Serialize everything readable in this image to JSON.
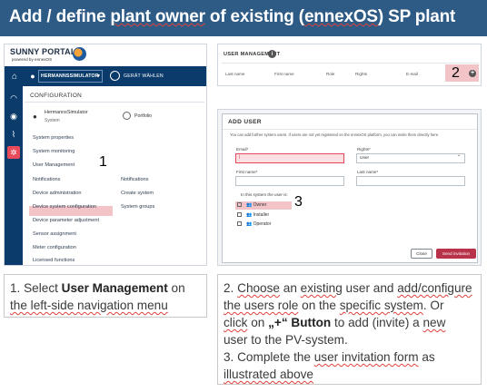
{
  "title": {
    "prefix": "Add / define ",
    "underlined": "plant owner",
    "mid": " of existing (",
    "ennex": "ennexOS",
    "suffix": ") SP plant"
  },
  "portal": {
    "logo": "SUNNY PORTAL",
    "logo_sub": "powered by ennexOS",
    "plant_selector": "HERMANNSSIMULATOR",
    "device_selector": "GERÄT WÄHLEN",
    "configuration_title": "CONFIGURATION",
    "plant_name": "HermannsSimulator",
    "plant_type": "System",
    "portfolio": "Portfolio",
    "menu_left": [
      "System properties",
      "System monitoring",
      "User Management",
      "Notifications",
      "Device administration",
      "Device system configuration",
      "Device parameter adjustment",
      "Sensor assignment",
      "Meter configuration",
      "Licensed functions"
    ],
    "menu_right": [
      "Notifications",
      "Create system",
      "System groups"
    ],
    "step_1": "1"
  },
  "user_management": {
    "title": "USER MANAGEMENT",
    "info": "i",
    "columns": [
      "Last name",
      "First name",
      "Role",
      "Rights",
      "E-mail"
    ],
    "add_symbol": "+",
    "step_2": "2"
  },
  "add_user": {
    "title": "ADD USER",
    "description": "You can add further system users. If users are not yet registered on the ennexOS platform, you can invite them directly here.",
    "email_label": "Email*",
    "email_value": "|",
    "rights_label": "Rights*",
    "rights_value": "User",
    "rights_arrow": "⌄",
    "first_name_label": "First name*",
    "last_name_label": "Last name*",
    "role_question": "In this system the user is:",
    "roles": [
      "Owner",
      "Installer",
      "Operator"
    ],
    "step_3": "3",
    "close_button": "Close",
    "send_button": "Send invitation"
  },
  "caption_left": {
    "prefix": "1. Select ",
    "bold": "User Management",
    "mid": " on",
    "line2": "the left-side navigation menu"
  },
  "caption_right": {
    "l1_num": "2. ",
    "l1_a": "Choose",
    "l1_b": " an ",
    "l1_c": "existing",
    "l1_d": " user and ",
    "l1_e": "add/configure",
    "l2_a": "the users role",
    "l2_b": " on the ",
    "l2_c": "specific system",
    "l2_d": ". Or",
    "l3_a": "click",
    "l3_b": " on ",
    "l3_c": "„+“ Button",
    "l3_d": " to add (invite) a ",
    "l3_e": "new",
    "l4": "user to the PV-system.",
    "l5_a": "3. Complete the ",
    "l5_b": "user invitation form",
    "l5_c": " as",
    "l6": "illustrated above"
  },
  "colors": {
    "banner": "#2e5b85",
    "portal_nav": "#0a3b6b",
    "highlight": "#f2c3c7",
    "send_button": "#b8334a"
  }
}
